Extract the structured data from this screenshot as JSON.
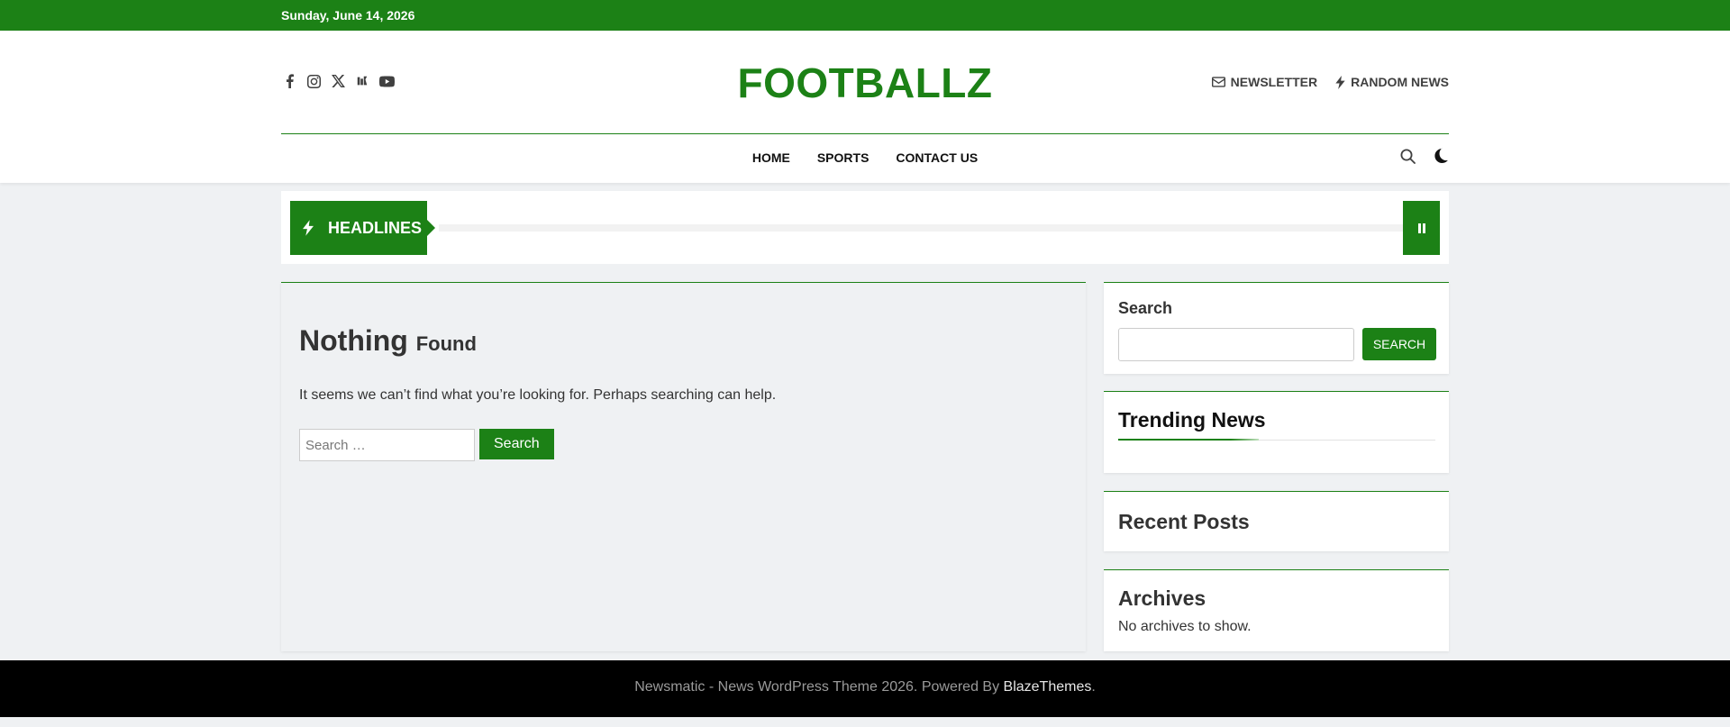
{
  "topbar": {
    "date": "Sunday, June 14, 2026"
  },
  "header": {
    "site_title": "FOOTBALLZ",
    "social_icons": [
      "facebook-icon",
      "instagram-icon",
      "x-twitter-icon",
      "threads-icon",
      "youtube-icon"
    ],
    "links": {
      "newsletter": "NEWSLETTER",
      "random_news": "RANDOM NEWS"
    }
  },
  "nav": {
    "items": [
      "HOME",
      "SPORTS",
      "CONTACT US"
    ]
  },
  "ticker": {
    "label": "HEADLINES"
  },
  "main": {
    "title_big": "Nothing",
    "title_small": "Found",
    "message": "It seems we can’t find what you’re looking for. Perhaps searching can help.",
    "search_placeholder": "Search …",
    "search_button": "Search"
  },
  "sidebar": {
    "search_title": "Search",
    "search_button": "SEARCH",
    "trending_title": "Trending News",
    "recent_title": "Recent Posts",
    "archives_title": "Archives",
    "archives_empty": "No archives to show."
  },
  "footer": {
    "text": "Newsmatic - News WordPress Theme 2026. Powered By ",
    "brand": "BlazeThemes",
    "suffix": "."
  },
  "colors": {
    "accent": "#1c8116",
    "footer_bg": "#000000",
    "page_bg": "#eff1f3"
  }
}
